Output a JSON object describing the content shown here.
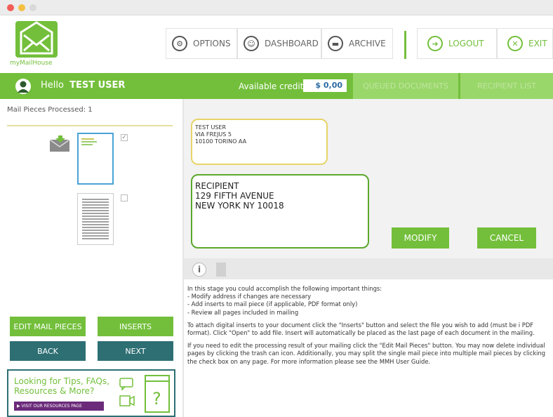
{
  "header": {
    "logo_text": "myMailHouse",
    "nav": {
      "options": "OPTIONS",
      "dashboard": "DASHBOARD",
      "archive": "ARCHIVE",
      "logout": "LOGOUT",
      "exit": "EXIT"
    }
  },
  "greenbar": {
    "hello": "Hello",
    "username": "TEST USER",
    "credits_label": "Available credits",
    "credits_value": "$ 0,00",
    "tabs": {
      "queued": "QUEUED DOCUMENTS",
      "recipient_list": "RECIPIENT LIST"
    }
  },
  "left": {
    "processed": "Mail Pieces Processed: 1",
    "buttons": {
      "edit": "EDIT MAIL PIECES",
      "inserts": "INSERTS",
      "back": "BACK",
      "next": "NEXT"
    },
    "promo": {
      "line1": "Looking for Tips, FAQs,",
      "line2": "Resources & More?",
      "link": "VISIT OUR RESOURCES PAGE"
    }
  },
  "main": {
    "sender": {
      "line1": "TEST USER",
      "line2": "VIA FREJUS 5",
      "line3": "10100 TORINO AA"
    },
    "recipient": {
      "line1": "RECIPIENT",
      "line2": "129 FIFTH AVENUE",
      "line3": "NEW YORK NY 10018"
    },
    "buttons": {
      "modify": "MODIFY",
      "cancel": "CANCEL"
    }
  },
  "info": {
    "intro": "In this stage you could accomplish the following important things:",
    "bullets": [
      "- Modify address if changes are necessary",
      "- Add inserts to mail piece (if applicable, PDF format only)",
      "- Review all pages included in mailing"
    ],
    "para1": "To attach digital inserts to your document click the \"Inserts\" button and select the file you wish to add (must be i PDF format). Click \"Open\" to add file. Insert will automatically be placed as the last page of each document in the mailing.",
    "para2": "If you need to edit the processing result of your mailing click the \"Edit Mail Pieces\" button. You may now delete individual pages by clicking the trash can icon. Additionally, you may split the single mail piece into multiple mail pieces by clicking the check box on any page. For more information please see the MMH User Guide."
  },
  "colors": {
    "brand_green": "#73bf3b",
    "teal": "#2d6f73",
    "sender_border": "#e7d468",
    "selected_page": "#4ba3d6"
  },
  "icons": [
    "gear-icon",
    "user-circle-icon",
    "folder-icon",
    "logout-arrow-icon",
    "close-circle-icon",
    "envelope-icon",
    "info-icon",
    "document-icon",
    "chat-icon",
    "video-icon",
    "question-icon"
  ]
}
